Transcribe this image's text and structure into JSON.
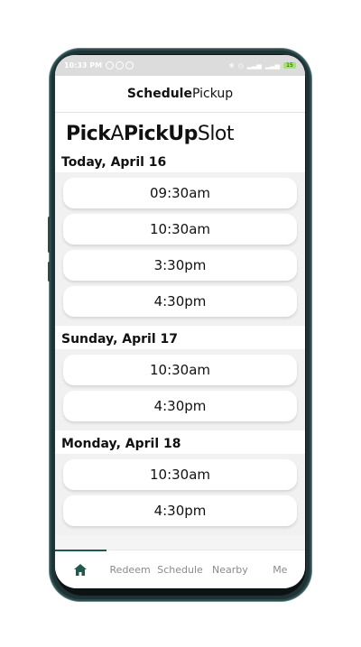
{
  "status": {
    "time": "10:33 PM",
    "battery": "15"
  },
  "appbar": {
    "title_bold": "Schedule",
    "title_regular": "Pickup"
  },
  "heading": {
    "part1": "Pick",
    "part2": "A",
    "part3": "PickUp",
    "part4": "Slot"
  },
  "days": [
    {
      "label": "Today, April 16",
      "slots": [
        "09:30am",
        "10:30am",
        "3:30pm",
        "4:30pm"
      ]
    },
    {
      "label": "Sunday, April 17",
      "slots": [
        "10:30am",
        "4:30pm"
      ]
    },
    {
      "label": "Monday, April 18",
      "slots": [
        "10:30am",
        "4:30pm"
      ]
    }
  ],
  "nav": {
    "home_icon": "home-icon",
    "items": [
      "Redeem",
      "Schedule",
      "Nearby",
      "Me"
    ]
  },
  "colors": {
    "accent": "#1f5a4c",
    "phone_frame": "#1f3336"
  }
}
